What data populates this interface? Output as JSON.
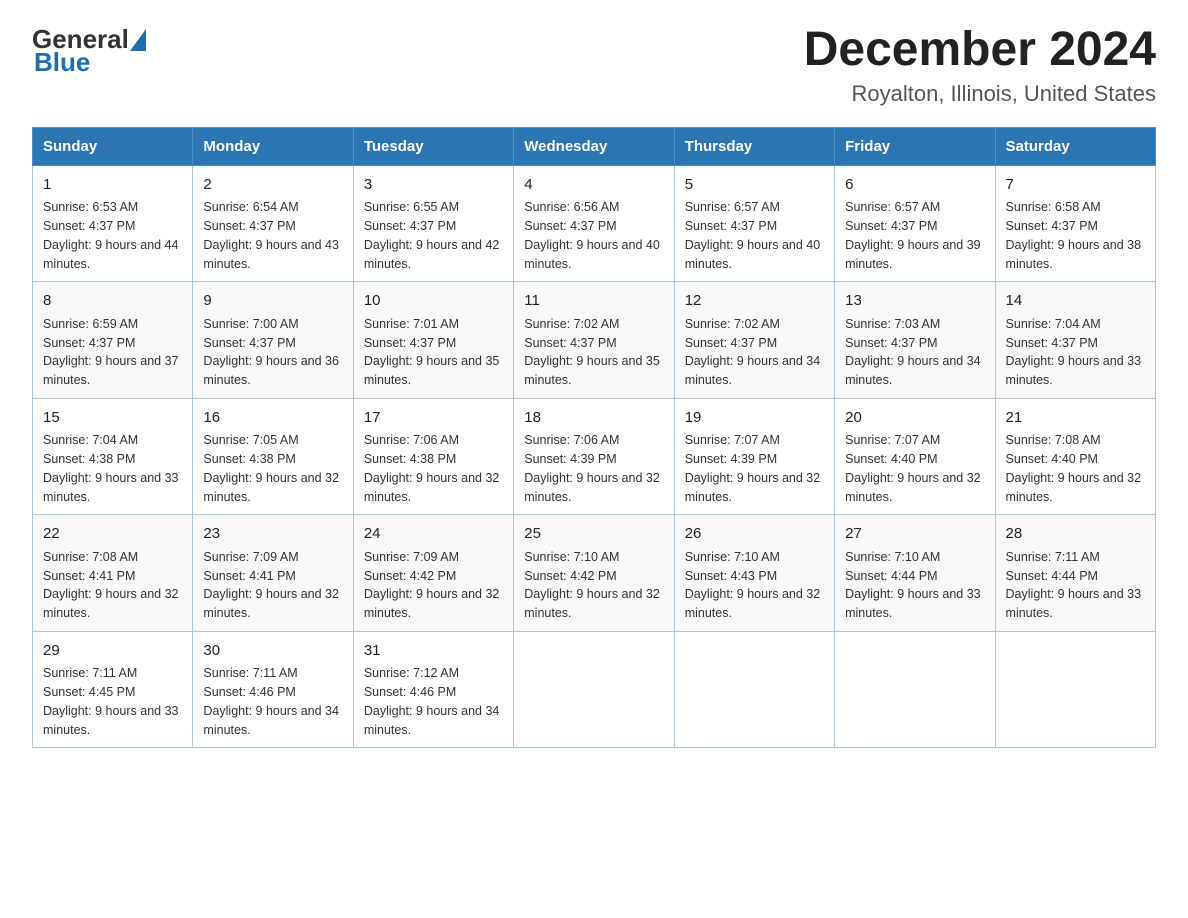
{
  "logo": {
    "general": "General",
    "blue": "Blue"
  },
  "header": {
    "title": "December 2024",
    "subtitle": "Royalton, Illinois, United States"
  },
  "weekdays": [
    "Sunday",
    "Monday",
    "Tuesday",
    "Wednesday",
    "Thursday",
    "Friday",
    "Saturday"
  ],
  "weeks": [
    [
      {
        "day": "1",
        "sunrise": "6:53 AM",
        "sunset": "4:37 PM",
        "daylight": "9 hours and 44 minutes."
      },
      {
        "day": "2",
        "sunrise": "6:54 AM",
        "sunset": "4:37 PM",
        "daylight": "9 hours and 43 minutes."
      },
      {
        "day": "3",
        "sunrise": "6:55 AM",
        "sunset": "4:37 PM",
        "daylight": "9 hours and 42 minutes."
      },
      {
        "day": "4",
        "sunrise": "6:56 AM",
        "sunset": "4:37 PM",
        "daylight": "9 hours and 40 minutes."
      },
      {
        "day": "5",
        "sunrise": "6:57 AM",
        "sunset": "4:37 PM",
        "daylight": "9 hours and 40 minutes."
      },
      {
        "day": "6",
        "sunrise": "6:57 AM",
        "sunset": "4:37 PM",
        "daylight": "9 hours and 39 minutes."
      },
      {
        "day": "7",
        "sunrise": "6:58 AM",
        "sunset": "4:37 PM",
        "daylight": "9 hours and 38 minutes."
      }
    ],
    [
      {
        "day": "8",
        "sunrise": "6:59 AM",
        "sunset": "4:37 PM",
        "daylight": "9 hours and 37 minutes."
      },
      {
        "day": "9",
        "sunrise": "7:00 AM",
        "sunset": "4:37 PM",
        "daylight": "9 hours and 36 minutes."
      },
      {
        "day": "10",
        "sunrise": "7:01 AM",
        "sunset": "4:37 PM",
        "daylight": "9 hours and 35 minutes."
      },
      {
        "day": "11",
        "sunrise": "7:02 AM",
        "sunset": "4:37 PM",
        "daylight": "9 hours and 35 minutes."
      },
      {
        "day": "12",
        "sunrise": "7:02 AM",
        "sunset": "4:37 PM",
        "daylight": "9 hours and 34 minutes."
      },
      {
        "day": "13",
        "sunrise": "7:03 AM",
        "sunset": "4:37 PM",
        "daylight": "9 hours and 34 minutes."
      },
      {
        "day": "14",
        "sunrise": "7:04 AM",
        "sunset": "4:37 PM",
        "daylight": "9 hours and 33 minutes."
      }
    ],
    [
      {
        "day": "15",
        "sunrise": "7:04 AM",
        "sunset": "4:38 PM",
        "daylight": "9 hours and 33 minutes."
      },
      {
        "day": "16",
        "sunrise": "7:05 AM",
        "sunset": "4:38 PM",
        "daylight": "9 hours and 32 minutes."
      },
      {
        "day": "17",
        "sunrise": "7:06 AM",
        "sunset": "4:38 PM",
        "daylight": "9 hours and 32 minutes."
      },
      {
        "day": "18",
        "sunrise": "7:06 AM",
        "sunset": "4:39 PM",
        "daylight": "9 hours and 32 minutes."
      },
      {
        "day": "19",
        "sunrise": "7:07 AM",
        "sunset": "4:39 PM",
        "daylight": "9 hours and 32 minutes."
      },
      {
        "day": "20",
        "sunrise": "7:07 AM",
        "sunset": "4:40 PM",
        "daylight": "9 hours and 32 minutes."
      },
      {
        "day": "21",
        "sunrise": "7:08 AM",
        "sunset": "4:40 PM",
        "daylight": "9 hours and 32 minutes."
      }
    ],
    [
      {
        "day": "22",
        "sunrise": "7:08 AM",
        "sunset": "4:41 PM",
        "daylight": "9 hours and 32 minutes."
      },
      {
        "day": "23",
        "sunrise": "7:09 AM",
        "sunset": "4:41 PM",
        "daylight": "9 hours and 32 minutes."
      },
      {
        "day": "24",
        "sunrise": "7:09 AM",
        "sunset": "4:42 PM",
        "daylight": "9 hours and 32 minutes."
      },
      {
        "day": "25",
        "sunrise": "7:10 AM",
        "sunset": "4:42 PM",
        "daylight": "9 hours and 32 minutes."
      },
      {
        "day": "26",
        "sunrise": "7:10 AM",
        "sunset": "4:43 PM",
        "daylight": "9 hours and 32 minutes."
      },
      {
        "day": "27",
        "sunrise": "7:10 AM",
        "sunset": "4:44 PM",
        "daylight": "9 hours and 33 minutes."
      },
      {
        "day": "28",
        "sunrise": "7:11 AM",
        "sunset": "4:44 PM",
        "daylight": "9 hours and 33 minutes."
      }
    ],
    [
      {
        "day": "29",
        "sunrise": "7:11 AM",
        "sunset": "4:45 PM",
        "daylight": "9 hours and 33 minutes."
      },
      {
        "day": "30",
        "sunrise": "7:11 AM",
        "sunset": "4:46 PM",
        "daylight": "9 hours and 34 minutes."
      },
      {
        "day": "31",
        "sunrise": "7:12 AM",
        "sunset": "4:46 PM",
        "daylight": "9 hours and 34 minutes."
      },
      null,
      null,
      null,
      null
    ]
  ]
}
